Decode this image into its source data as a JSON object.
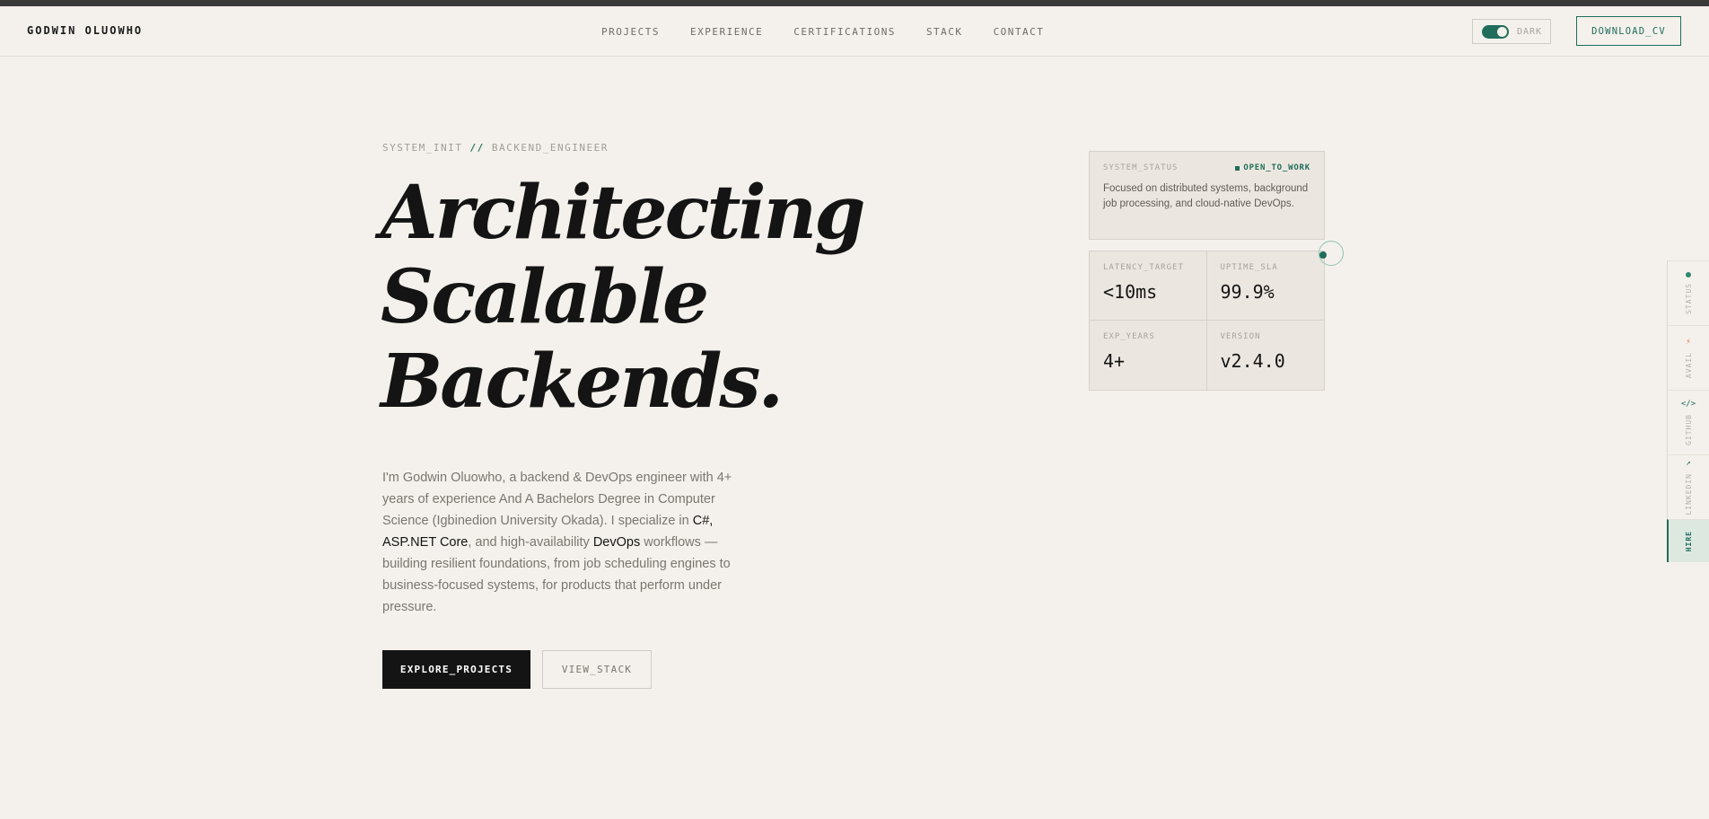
{
  "header": {
    "logo": "GODWIN OLUOWHO",
    "nav": [
      "PROJECTS",
      "EXPERIENCE",
      "CERTIFICATIONS",
      "STACK",
      "CONTACT"
    ],
    "theme_label": "DARK",
    "download_label": "DOWNLOAD_CV"
  },
  "hero": {
    "kicker_left": "SYSTEM_INIT",
    "kicker_sep": "//",
    "kicker_right": "BACKEND_ENGINEER",
    "headline_1": "Architecting",
    "headline_2": "Scalable",
    "headline_3": "Backends.",
    "bio_1": "I'm Godwin Oluowho, a backend & DevOps engineer with 4+ years of experience And A Bachelors Degree in Computer Science (Igbinedion University Okada). I specialize in ",
    "bio_em1": "C#, ASP.NET Core",
    "bio_2": ", and high-availability ",
    "bio_em2": "DevOps",
    "bio_3": " workflows — building resilient foundations, from job scheduling engines to business-focused systems, for products that perform under pressure.",
    "primary_label": "EXPLORE_PROJECTS",
    "secondary_label": "VIEW_STACK"
  },
  "status": {
    "label": "SYSTEM_STATUS",
    "badge": "OPEN_TO_WORK",
    "text": "Focused on distributed systems, background job processing, and cloud-native DevOps."
  },
  "metrics": [
    {
      "label": "LATENCY_TARGET",
      "value": "<10ms"
    },
    {
      "label": "UPTIME_SLA",
      "value": "99.9%"
    },
    {
      "label": "EXP_YEARS",
      "value": "4+"
    },
    {
      "label": "VERSION",
      "value": "v2.4.0"
    }
  ],
  "rail": [
    {
      "label": "STATUS",
      "icon": "status-dot"
    },
    {
      "label": "AVAIL",
      "icon": "⚡"
    },
    {
      "label": "GITHUB",
      "icon": "</>"
    },
    {
      "label": "LINKEDIN",
      "icon": "↗"
    },
    {
      "label": "HIRE",
      "icon": ""
    }
  ],
  "colors": {
    "accent": "#1f6d5a",
    "background": "#f4f1ec",
    "ink": "#141414"
  }
}
